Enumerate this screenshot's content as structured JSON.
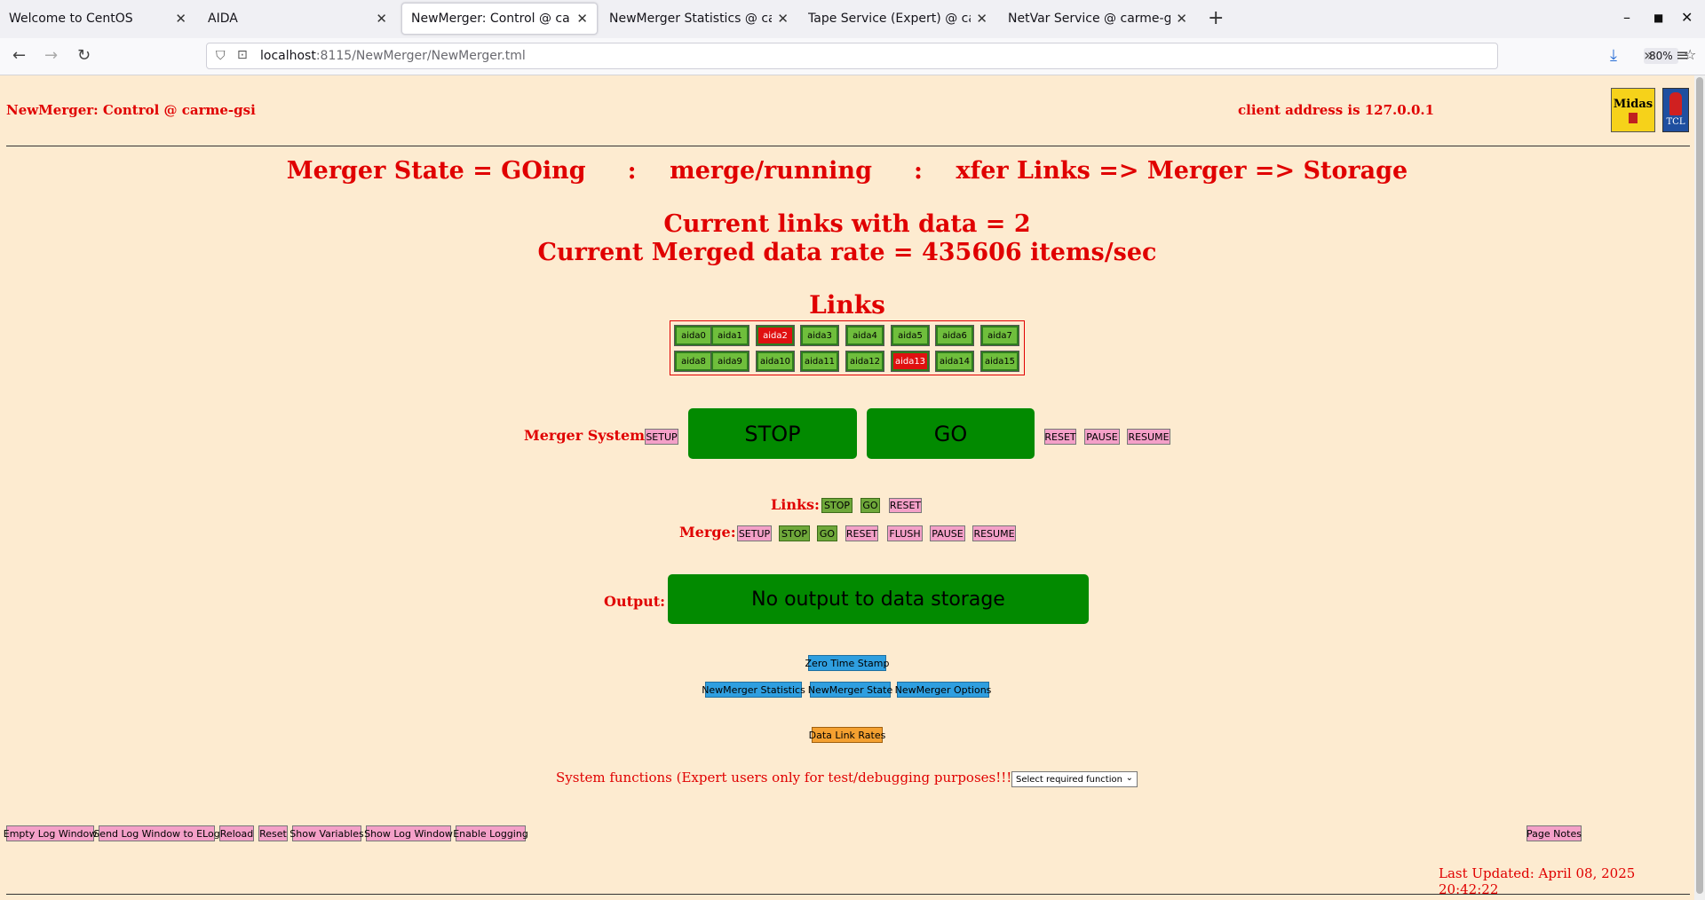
{
  "browser": {
    "tabs": [
      {
        "label": "Welcome to CentOS"
      },
      {
        "label": "AIDA"
      },
      {
        "label": "NewMerger: Control @ carme-gsi"
      },
      {
        "label": "NewMerger Statistics @ carme-gsi"
      },
      {
        "label": "Tape Service (Expert) @ carme-gsi"
      },
      {
        "label": "NetVar Service @ carme-gsi"
      }
    ],
    "url_host": "localhost",
    "url_path": ":8115/NewMerger/NewMerger.tml",
    "zoom": "80%"
  },
  "page": {
    "title": "NewMerger: Control @ carme-gsi",
    "client_address": "client address is 127.0.0.1",
    "logo_midas": "Midas",
    "logo_tcl": "TCL",
    "merger_state": "Merger State = GOing     :    merge/running     :    xfer Links => Merger => Storage",
    "current_links": "Current links with data = 2",
    "current_rate": "Current Merged data rate = 435606 items/sec",
    "links_title": "Links",
    "links": [
      {
        "label": "aida0",
        "status": "ok"
      },
      {
        "label": "aida1",
        "status": "ok"
      },
      {
        "label": "aida2",
        "status": "error"
      },
      {
        "label": "aida3",
        "status": "ok"
      },
      {
        "label": "aida4",
        "status": "ok"
      },
      {
        "label": "aida5",
        "status": "ok"
      },
      {
        "label": "aida6",
        "status": "ok"
      },
      {
        "label": "aida7",
        "status": "ok"
      },
      {
        "label": "aida8",
        "status": "ok"
      },
      {
        "label": "aida9",
        "status": "ok"
      },
      {
        "label": "aida10",
        "status": "ok"
      },
      {
        "label": "aida11",
        "status": "ok"
      },
      {
        "label": "aida12",
        "status": "ok"
      },
      {
        "label": "aida13",
        "status": "error"
      },
      {
        "label": "aida14",
        "status": "ok"
      },
      {
        "label": "aida15",
        "status": "ok"
      }
    ],
    "merger_system": {
      "label": "Merger System:",
      "setup": "SETUP",
      "stop": "STOP",
      "go": "GO",
      "reset": "RESET",
      "pause": "PAUSE",
      "resume": "RESUME"
    },
    "links_ctl": {
      "label": "Links:",
      "stop": "STOP",
      "go": "GO",
      "reset": "RESET"
    },
    "merge_ctl": {
      "label": "Merge:",
      "setup": "SETUP",
      "stop": "STOP",
      "go": "GO",
      "reset": "RESET",
      "flush": "FLUSH",
      "pause": "PAUSE",
      "resume": "RESUME"
    },
    "output": {
      "label": "Output:",
      "value": "No output to data storage"
    },
    "zero_ts": "Zero Time Stamp",
    "nav": {
      "stats": "NewMerger Statistics",
      "state": "NewMerger State",
      "options": "NewMerger Options"
    },
    "data_link_rates": "Data Link Rates",
    "system_functions": "System functions (Expert users only for test/debugging purposes!!!)",
    "select_placeholder": "Select required function",
    "footer_buttons": {
      "empty_log": "Empty Log Window",
      "send_log": "Send Log Window to ELog",
      "reload": "Reload",
      "reset": "Reset",
      "show_vars": "Show Variables",
      "show_log": "Show Log Window",
      "enable_logging": "Enable Logging",
      "page_notes": "Page Notes"
    },
    "last_updated": "Last Updated: April 08, 2025 20:42:22"
  },
  "colors": {
    "text_red": "#e00000",
    "page_bg": "#fdebd0",
    "big_button_green": "#028a00",
    "link_ok": "#6fbe3c",
    "link_error": "#e01010"
  }
}
